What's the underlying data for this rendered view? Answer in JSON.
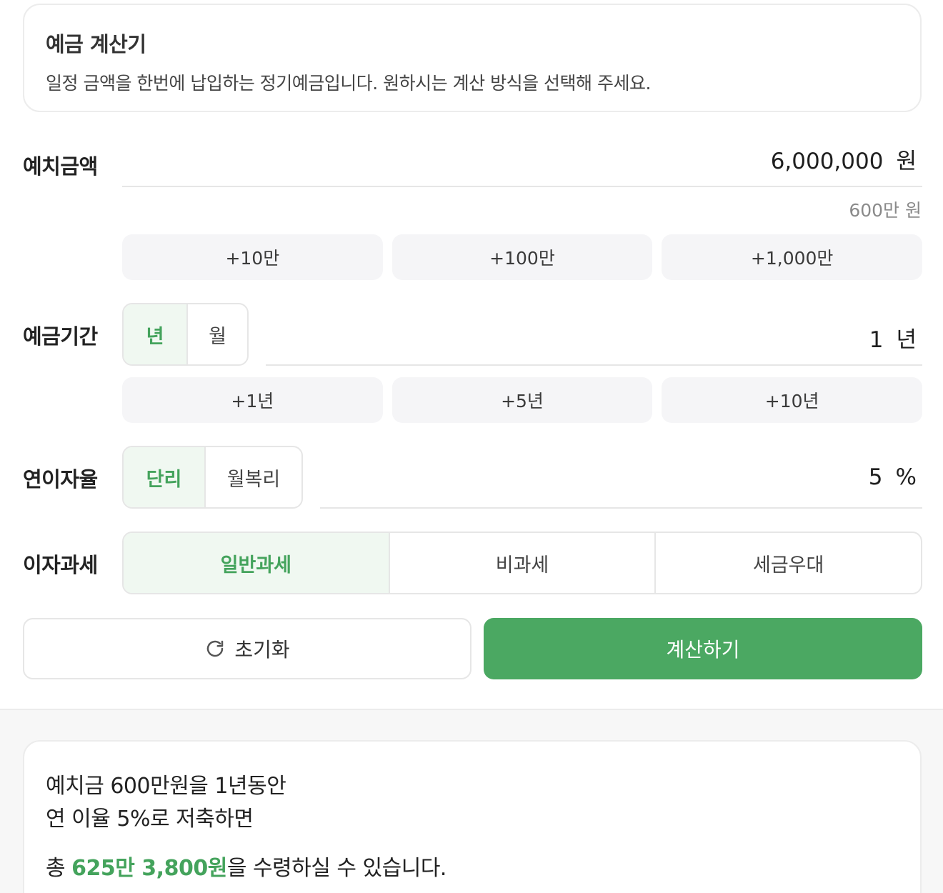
{
  "info": {
    "title": "예금 계산기",
    "description": "일정 금액을 한번에 납입하는 정기예금입니다. 원하시는 계산 방식을 선택해 주세요."
  },
  "deposit": {
    "label": "예치금액",
    "value": "6,000,000",
    "unit": "원",
    "hint": "600만 원",
    "chips": [
      "+10만",
      "+100만",
      "+1,000만"
    ]
  },
  "period": {
    "label": "예금기간",
    "modes": [
      "년",
      "월"
    ],
    "selected_mode": "년",
    "value": "1",
    "unit": "년",
    "chips": [
      "+1년",
      "+5년",
      "+10년"
    ]
  },
  "rate": {
    "label": "연이자율",
    "modes": [
      "단리",
      "월복리"
    ],
    "selected_mode": "단리",
    "value": "5",
    "unit": "%"
  },
  "tax": {
    "label": "이자과세",
    "options": [
      "일반과세",
      "비과세",
      "세금우대"
    ],
    "selected": "일반과세"
  },
  "buttons": {
    "reset_label": "초기화",
    "calc_label": "계산하기"
  },
  "icons": {
    "reset": "refresh-icon"
  },
  "colors": {
    "accent": "#4ba862",
    "accent_text": "#44a35c",
    "accent_bg": "#f0f8f1"
  },
  "result": {
    "line1": "예치금 600만원을 1년동안",
    "line2": "연 이율 5%로 저축하면",
    "total_prefix": "총 ",
    "total_amount": "625만 3,800원",
    "total_suffix": "을 수령하실 수 있습니다."
  }
}
